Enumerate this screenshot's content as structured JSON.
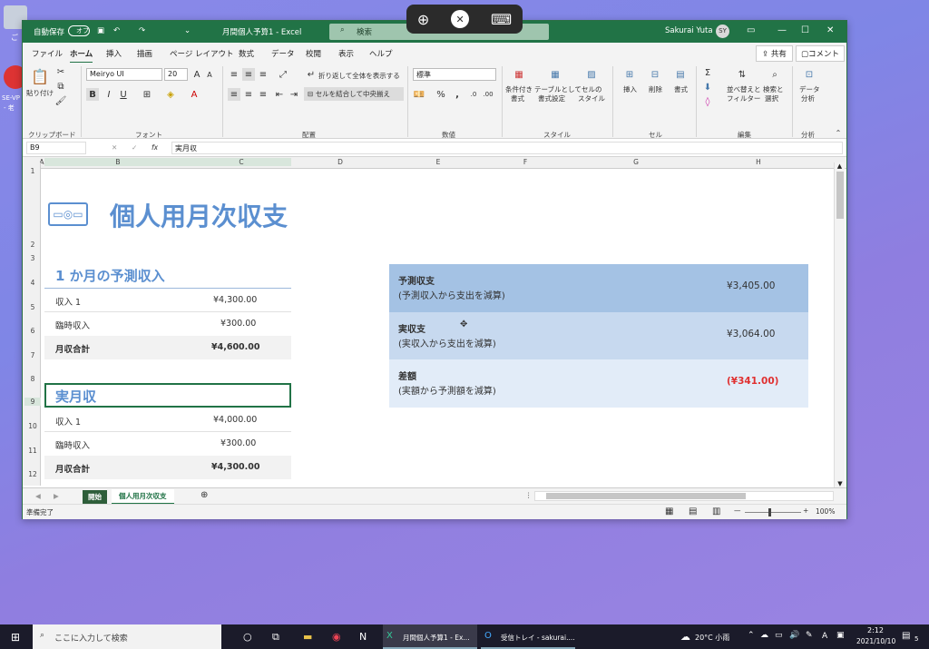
{
  "desktop": {
    "recycle_label": "ご",
    "icon2_label": "SE-VP",
    "icon2_sub": "- 老"
  },
  "remote_toolbar": {
    "zoom_icon": "zoom-in-icon",
    "connect_icon": "remote-desktop-icon",
    "keyboard_icon": "keyboard-icon"
  },
  "titlebar": {
    "autosave": "自動保存",
    "autosave_state": "オフ",
    "title": "月間個人予算1 - Excel",
    "search_placeholder": "検索",
    "user": "Sakurai Yuta",
    "avatar": "SY"
  },
  "menu": {
    "items": [
      "ファイル",
      "ホーム",
      "挿入",
      "描画",
      "ページ レイアウト",
      "数式",
      "データ",
      "校閲",
      "表示",
      "ヘルプ"
    ],
    "share": "共有",
    "comment": "コメント"
  },
  "ribbon": {
    "clipboard": {
      "paste": "貼り付け",
      "label": "クリップボード"
    },
    "font": {
      "name": "Meiryo UI",
      "size": "20",
      "label": "フォント"
    },
    "align": {
      "wrap": "折り返して全体を表示する",
      "merge": "セルを結合して中央揃え",
      "label": "配置"
    },
    "number": {
      "format": "標準",
      "label": "数値"
    },
    "style": {
      "cond": "条件付き",
      "cond2": "書式",
      "table": "テーブルとして",
      "table2": "書式設定",
      "cell": "セルの",
      "cell2": "スタイル",
      "label": "スタイル"
    },
    "cells": {
      "insert": "挿入",
      "delete": "削除",
      "format": "書式",
      "label": "セル"
    },
    "edit": {
      "sort": "並べ替えと",
      "sort2": "フィルター",
      "find": "検索と",
      "find2": "選択",
      "label": "編集"
    },
    "analysis": {
      "data": "データ",
      "data2": "分析",
      "label": "分析"
    }
  },
  "formula": {
    "namebox": "B9",
    "fx": "fx",
    "value": "実月収"
  },
  "columns": [
    "A",
    "B",
    "C",
    "D",
    "E",
    "F",
    "G",
    "H"
  ],
  "rows": [
    "1",
    "2",
    "3",
    "4",
    "5",
    "6",
    "7",
    "8",
    "9",
    "10",
    "11",
    "12"
  ],
  "sheet": {
    "title": "個人用月次収支",
    "projected": {
      "heading": "1 か月の予測収入",
      "rows": [
        {
          "label": "収入 1",
          "value": "¥4,300.00"
        },
        {
          "label": "臨時収入",
          "value": "¥300.00"
        }
      ],
      "total_label": "月収合計",
      "total_value": "¥4,600.00"
    },
    "actual": {
      "heading": "実月収",
      "rows": [
        {
          "label": "収入 1",
          "value": "¥4,000.00"
        },
        {
          "label": "臨時収入",
          "value": "¥300.00"
        }
      ],
      "total_label": "月収合計",
      "total_value": "¥4,300.00"
    },
    "summary": [
      {
        "title": "予測収支",
        "sub": "(予測収入から支出を減算)",
        "value": "¥3,405.00"
      },
      {
        "title": "実収支",
        "sub": "(実収入から支出を減算)",
        "value": "¥3,064.00"
      },
      {
        "title": "差額",
        "sub": "(実額から予測額を減算)",
        "value": "(¥341.00)"
      }
    ]
  },
  "tabs": [
    "開始",
    "個人用月次収支"
  ],
  "status": {
    "ready": "準備完了",
    "zoom": "100%"
  },
  "taskbar": {
    "search": "ここに入力して検索",
    "app1": "月間個人予算1 - Ex...",
    "app2": "受信トレイ - sakurai....",
    "weather": "20°C 小雨",
    "ime": "A",
    "time": "2:12",
    "date": "2021/10/10",
    "notif": "5"
  },
  "colors": {
    "accent": "#217346",
    "heading": "#5b8fd0",
    "band1": "#a4c2e4",
    "band2": "#c7d9ef",
    "band3": "#e2ecf8",
    "negative": "#e03030"
  }
}
